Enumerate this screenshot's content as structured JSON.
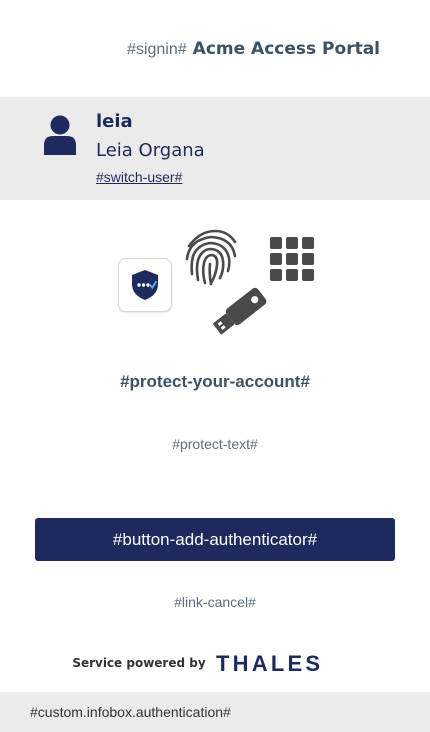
{
  "header": {
    "signin_label": "#signin#",
    "portal_title": "Acme Access Portal"
  },
  "user": {
    "username": "leia",
    "full_name": "Leia Organa",
    "switch_user_link": "#switch-user#"
  },
  "illustration": {
    "icons": [
      "shield-app-icon",
      "fingerprint-icon",
      "keypad-icon",
      "usb-key-icon"
    ]
  },
  "main": {
    "protect_title": "#protect-your-account#",
    "protect_text": "#protect-text#",
    "add_authenticator_button": "#button-add-authenticator#",
    "cancel_link": "#link-cancel#"
  },
  "footer": {
    "powered_by": "Service powered by",
    "brand": "THALES",
    "infobox": "#custom.infobox.authentication#"
  },
  "colors": {
    "primary": "#1e2a5e",
    "heading": "#3a5266",
    "muted_text": "#5b6f82",
    "band_bg": "#ebebeb",
    "icon_gray": "#4a4a4a"
  }
}
